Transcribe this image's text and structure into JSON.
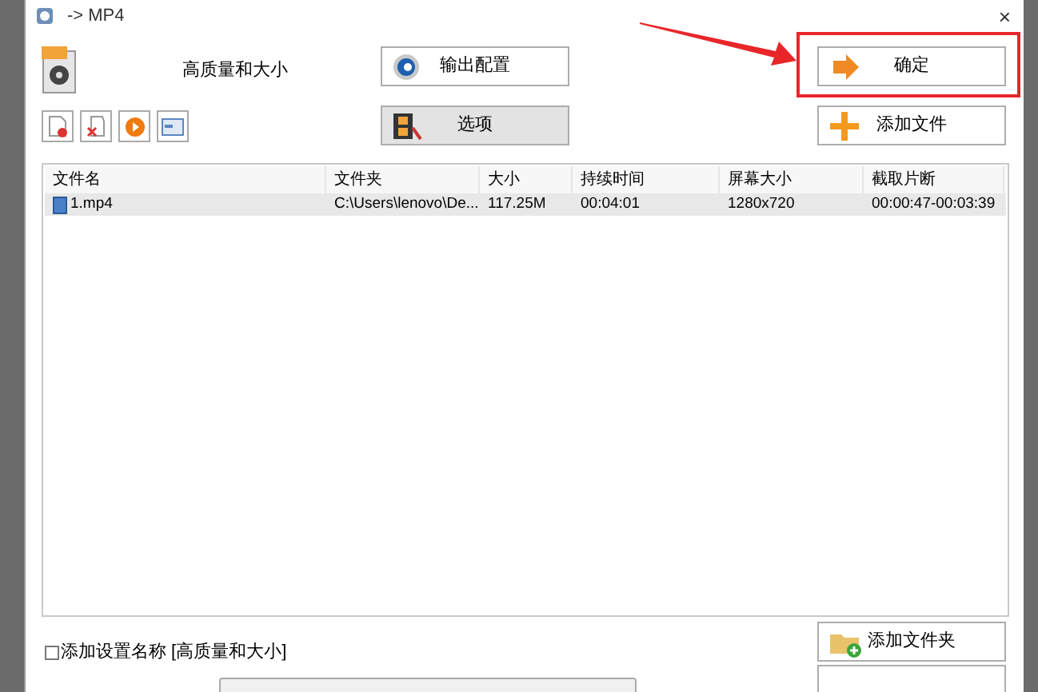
{
  "window": {
    "title": "-> MP4",
    "close": "×"
  },
  "profile": {
    "label": "高质量和大小"
  },
  "buttons": {
    "output_settings": "输出配置",
    "ok": "确定",
    "options": "选项",
    "add_file": "添加文件",
    "add_folder": "添加文件夹"
  },
  "table": {
    "columns": [
      "文件名",
      "文件夹",
      "大小",
      "持续时间",
      "屏幕大小",
      "截取片断"
    ],
    "rows": [
      {
        "selected": true,
        "cells": [
          "1.mp4",
          "C:\\Users\\lenovo\\De...",
          "117.25M",
          "00:04:01",
          "1280x720",
          "00:00:47-00:03:39"
        ]
      }
    ]
  },
  "add_setting_name": {
    "label": "添加设置名称 [高质量和大小]",
    "checked": false
  }
}
